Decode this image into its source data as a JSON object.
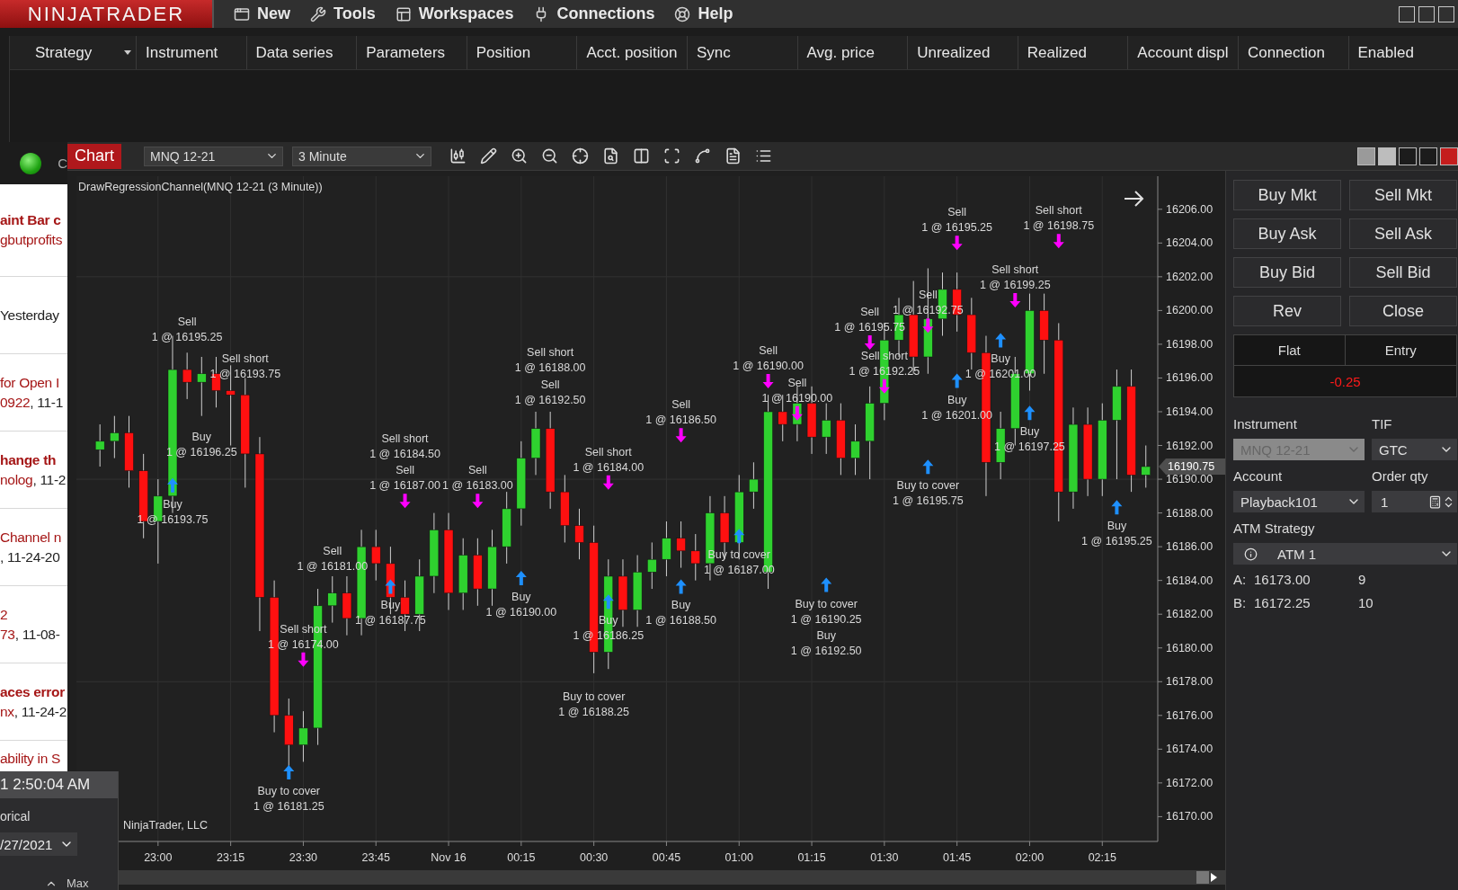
{
  "app": {
    "logo": "NINJATRADER",
    "menu": [
      {
        "label": "New"
      },
      {
        "label": "Tools"
      },
      {
        "label": "Workspaces"
      },
      {
        "label": "Connections"
      },
      {
        "label": "Help"
      }
    ]
  },
  "strategies": {
    "columns": [
      "Strategy",
      "Instrument",
      "Data series",
      "Parameters",
      "Position",
      "Acct. position",
      "Sync",
      "Avg. price",
      "Unrealized",
      "Realized",
      "Account displ",
      "Connection",
      "Enabled"
    ]
  },
  "status": {
    "label": "C"
  },
  "forum_posts": [
    {
      "title": "aint Bar c",
      "unread": true,
      "author": "gbutprofits"
    },
    {
      "date": "Yesterday"
    },
    {
      "title": "for Open I",
      "unread": false,
      "author": "0922",
      "date": ", 11-1"
    },
    {
      "title": "hange th",
      "unread": true,
      "author": "nolog",
      "date": ", 11-2"
    },
    {
      "title": "Channel n",
      "unread": false,
      "date": ", 11-24-20"
    },
    {
      "title": "2",
      "unread": false,
      "author": "73",
      "date": ", 11-08-"
    },
    {
      "title": "aces error",
      "unread": true,
      "author": "nx",
      "date": ", 11-24-2"
    },
    {
      "title": "ability in S",
      "unread": false
    }
  ],
  "clock_panel": {
    "time": "1 2:50:04 AM",
    "mode": "orical",
    "date": "/27/2021",
    "max_label": "Max"
  },
  "chart_window": {
    "tab": "Chart",
    "instrument": "MNQ 12-21",
    "interval": "3 Minute",
    "indicator": "DrawRegressionChannel(MNQ 12-21 (3 Minute))",
    "copyright": "NinjaTrader, LLC",
    "last_price": "16190.75",
    "chart_data": {
      "type": "candlestick",
      "grid": true,
      "ylim": [
        16168.53,
        16207.96
      ],
      "categories": [
        null,
        null,
        null,
        null,
        "23:00",
        null,
        null,
        null,
        null,
        "23:15",
        null,
        null,
        null,
        null,
        "23:30",
        null,
        null,
        null,
        null,
        "23:45",
        null,
        null,
        null,
        null,
        "Nov 16",
        null,
        null,
        null,
        null,
        "00:15",
        null,
        null,
        null,
        null,
        "00:30",
        null,
        null,
        null,
        null,
        "00:45",
        null,
        null,
        null,
        null,
        "01:00",
        null,
        null,
        null,
        null,
        "01:15",
        null,
        null,
        null,
        null,
        "01:30",
        null,
        null,
        null,
        null,
        "01:45",
        null,
        null,
        null,
        null,
        "02:00",
        null,
        null,
        null,
        null,
        "02:15",
        null,
        null,
        null
      ],
      "yticks": [
        {
          "value": 16206,
          "label": "16206.00"
        },
        {
          "value": 16204,
          "label": "16204.00"
        },
        {
          "value": 16202,
          "label": "16202.00"
        },
        {
          "value": 16200,
          "label": "16200.00"
        },
        {
          "value": 16198,
          "label": "16198.00"
        },
        {
          "value": 16196,
          "label": "16196.00"
        },
        {
          "value": 16194,
          "label": "16194.00"
        },
        {
          "value": 16192,
          "label": "16192.00"
        },
        {
          "value": 16190,
          "label": "16190.00"
        },
        {
          "value": 16188,
          "label": "16188.00"
        },
        {
          "value": 16186,
          "label": "16186.00"
        },
        {
          "value": 16184,
          "label": "16184.00"
        },
        {
          "value": 16182,
          "label": "16182.00"
        },
        {
          "value": 16180,
          "label": "16180.00"
        },
        {
          "value": 16178,
          "label": "16178.00"
        },
        {
          "value": 16176,
          "label": "16176.00"
        },
        {
          "value": 16174,
          "label": "16174.00"
        },
        {
          "value": 16172,
          "label": "16172.00"
        },
        {
          "value": 16170,
          "label": "16170.00"
        }
      ],
      "ohlc": [
        [
          16191.75,
          16193.25,
          16190.75,
          16192.25
        ],
        [
          16192.25,
          16193.75,
          16191.25,
          16192.75
        ],
        [
          16192.75,
          16193.75,
          16189.5,
          16190.5
        ],
        [
          16190.5,
          16191.5,
          16186.5,
          16187.5
        ],
        [
          16187.5,
          16190,
          16185,
          16189
        ],
        [
          16189,
          16198.5,
          16188,
          16196.5
        ],
        [
          16196.5,
          16197.5,
          16194.75,
          16195.75
        ],
        [
          16195.75,
          16197.25,
          16193.75,
          16196.25
        ],
        [
          16196.25,
          16197.25,
          16194.25,
          16195.25
        ],
        [
          16195.25,
          16196.75,
          16192,
          16195
        ],
        [
          16195,
          16196,
          16189.5,
          16191.5
        ],
        [
          16191.5,
          16192.5,
          16181,
          16183
        ],
        [
          16183,
          16184,
          16175,
          16176
        ],
        [
          16176,
          16177,
          16173,
          16174.25
        ],
        [
          16174.25,
          16176.25,
          16173.25,
          16175.25
        ],
        [
          16175.25,
          16183.5,
          16174.25,
          16182.5
        ],
        [
          16182.5,
          16184.25,
          16181.5,
          16183.25
        ],
        [
          16183.25,
          16184.25,
          16180.75,
          16181.75
        ],
        [
          16181.75,
          16187,
          16180.75,
          16186
        ],
        [
          16186,
          16187,
          16184,
          16185
        ],
        [
          16185,
          16186,
          16182,
          16183
        ],
        [
          16183,
          16184,
          16181,
          16182
        ],
        [
          16182,
          16185.25,
          16181,
          16184.25
        ],
        [
          16184.25,
          16188,
          16183.25,
          16187
        ],
        [
          16187,
          16188,
          16182.25,
          16183.25
        ],
        [
          16183.25,
          16186.5,
          16182.25,
          16185.5
        ],
        [
          16185.5,
          16186.5,
          16182.5,
          16183.5
        ],
        [
          16183.5,
          16187,
          16182.5,
          16186
        ],
        [
          16186,
          16189.25,
          16185,
          16188.25
        ],
        [
          16188.25,
          16192.25,
          16187.25,
          16191.25
        ],
        [
          16191.25,
          16194,
          16190.25,
          16193
        ],
        [
          16193,
          16194,
          16188.25,
          16189.25
        ],
        [
          16189.25,
          16190.25,
          16186.25,
          16187.25
        ],
        [
          16187.25,
          16188.25,
          16185.25,
          16186.25
        ],
        [
          16186.25,
          16187.25,
          16178.5,
          16179.75
        ],
        [
          16179.75,
          16185.25,
          16178.75,
          16184.25
        ],
        [
          16184.25,
          16185.25,
          16181.25,
          16182.25
        ],
        [
          16182.25,
          16185.5,
          16181.25,
          16184.5
        ],
        [
          16184.5,
          16186.25,
          16183.5,
          16185.25
        ],
        [
          16185.25,
          16187.5,
          16184.25,
          16186.5
        ],
        [
          16186.5,
          16187.5,
          16184.75,
          16185.75
        ],
        [
          16185.75,
          16186.75,
          16184,
          16185
        ],
        [
          16185,
          16189,
          16184,
          16188
        ],
        [
          16188,
          16189,
          16185.25,
          16186.25
        ],
        [
          16186.25,
          16190.25,
          16185.25,
          16189.25
        ],
        [
          16189.25,
          16191,
          16188.25,
          16190
        ],
        [
          16184.5,
          16195,
          16183.5,
          16194
        ],
        [
          16194,
          16195,
          16192.25,
          16193.25
        ],
        [
          16193.25,
          16195.5,
          16192.25,
          16194.5
        ],
        [
          16194.5,
          16195.5,
          16191.5,
          16192.5
        ],
        [
          16192.5,
          16194.5,
          16191.5,
          16193.5
        ],
        [
          16193.5,
          16194.5,
          16190.25,
          16191.25
        ],
        [
          16191.25,
          16193.25,
          16190.25,
          16192.25
        ],
        [
          16192.25,
          16195.5,
          16190,
          16194.5
        ],
        [
          16194.5,
          16199.25,
          16193.5,
          16198.25
        ],
        [
          16198.25,
          16200.75,
          16197.25,
          16199.75
        ],
        [
          16199.75,
          16201.75,
          16196.25,
          16197.25
        ],
        [
          16197.25,
          16202.5,
          16196.25,
          16199.5
        ],
        [
          16199.5,
          16202.25,
          16198.5,
          16201.25
        ],
        [
          16201.25,
          16202.25,
          16198.75,
          16199.75
        ],
        [
          16199.75,
          16200.75,
          16196.5,
          16197.5
        ],
        [
          16197.5,
          16198.5,
          16189,
          16191
        ],
        [
          16191,
          16194,
          16190,
          16193
        ],
        [
          16193,
          16197.25,
          16192,
          16196.25
        ],
        [
          16196.25,
          16201,
          16195.25,
          16200
        ],
        [
          16200,
          16201,
          16196.25,
          16198.25
        ],
        [
          16198.25,
          16199.25,
          16187.5,
          16189.25
        ],
        [
          16189.25,
          16194.25,
          16188.25,
          16193.25
        ],
        [
          16193.25,
          16194.25,
          16189,
          16190
        ],
        [
          16190,
          16194.5,
          16189,
          16193.5
        ],
        [
          16193.5,
          16196.5,
          16190,
          16195.5
        ],
        [
          16195.5,
          16196.5,
          16189.25,
          16190.25
        ],
        [
          16190.25,
          16192,
          16189.5,
          16190.75
        ]
      ]
    },
    "trades": [
      {
        "kind": "sell",
        "action": "Sell",
        "fill": "1 @ 16195.25"
      },
      {
        "kind": "sell",
        "action": "Sell short",
        "fill": "1 @ 16193.75"
      },
      {
        "kind": "buy",
        "action": "Buy",
        "fill": "1 @ 16196.25"
      },
      {
        "kind": "buy",
        "action": "Buy",
        "fill": "1 @ 16193.75"
      },
      {
        "kind": "sell",
        "action": "Sell short",
        "fill": "1 @ 16184.50"
      },
      {
        "kind": "sell",
        "action": "Sell",
        "fill": "1 @ 16187.00"
      },
      {
        "kind": "sell",
        "action": "Sell",
        "fill": "1 @ 16183.00"
      },
      {
        "kind": "sell",
        "action": "Sell short",
        "fill": "1 @ 16188.00"
      },
      {
        "kind": "sell",
        "action": "Sell",
        "fill": "1 @ 16192.50"
      },
      {
        "kind": "sell",
        "action": "Sell short",
        "fill": "1 @ 16184.00"
      },
      {
        "kind": "sell",
        "action": "Sell",
        "fill": "1 @ 16186.50"
      },
      {
        "kind": "sell",
        "action": "Sell",
        "fill": "1 @ 16190.00"
      },
      {
        "kind": "sell",
        "action": "Sell",
        "fill": "1 @ 16190.00"
      },
      {
        "kind": "sell",
        "action": "Sell",
        "fill": "1 @ 16195.75"
      },
      {
        "kind": "sell",
        "action": "Sell short",
        "fill": "1 @ 16192.25"
      },
      {
        "kind": "sell",
        "action": "Sell",
        "fill": "1 @ 16192.75"
      },
      {
        "kind": "sell",
        "action": "Sell",
        "fill": "1 @ 16195.25"
      },
      {
        "kind": "sell",
        "action": "Sell short",
        "fill": "1 @ 16199.25"
      },
      {
        "kind": "sell",
        "action": "Sell short",
        "fill": "1 @ 16198.75"
      },
      {
        "kind": "buy",
        "action": "Buy",
        "fill": "1 @ 16201.00"
      },
      {
        "kind": "buy",
        "action": "Buy",
        "fill": "1 @ 16201.00"
      },
      {
        "kind": "buy",
        "action": "Buy",
        "fill": "1 @ 16197.25"
      },
      {
        "kind": "buy",
        "action": "Buy",
        "fill": "1 @ 16195.25"
      },
      {
        "kind": "buy",
        "action": "Buy to cover",
        "fill": "1 @ 16195.75"
      },
      {
        "kind": "buy",
        "action": "Buy to cover",
        "fill": "1 @ 16190.25"
      },
      {
        "kind": "buy",
        "action": "Buy",
        "fill": "1 @ 16192.50"
      },
      {
        "kind": "buy",
        "action": "Buy to cover",
        "fill": "1 @ 16187.00"
      },
      {
        "kind": "buy",
        "action": "Buy",
        "fill": "1 @ 16188.50"
      },
      {
        "kind": "buy",
        "action": "Buy",
        "fill": "1 @ 16186.25"
      },
      {
        "kind": "buy",
        "action": "Buy to cover",
        "fill": "1 @ 16188.25"
      },
      {
        "kind": "buy",
        "action": "Buy",
        "fill": "1 @ 16190.00"
      },
      {
        "kind": "buy",
        "action": "Buy",
        "fill": "1 @ 16187.75"
      },
      {
        "kind": "sell",
        "action": "Sell",
        "fill": "1 @ 16181.00"
      },
      {
        "kind": "sell",
        "action": "Sell short",
        "fill": "1 @ 16174.00"
      },
      {
        "kind": "buy",
        "action": "Buy to cover",
        "fill": "1 @ 16181.25"
      }
    ]
  },
  "chart_trader": {
    "buttons": [
      "Buy Mkt",
      "Sell Mkt",
      "Buy Ask",
      "Sell Ask",
      "Buy Bid",
      "Sell Bid",
      "Rev",
      "Close"
    ],
    "position": {
      "status": "Flat",
      "entry": "Entry",
      "pnl": "-0.25",
      "loss": true
    },
    "instrument": {
      "label": "Instrument",
      "value": "MNQ 12-21",
      "disabled": true
    },
    "tif": {
      "label": "TIF",
      "value": "GTC",
      "disabled": false
    },
    "account": {
      "label": "Account",
      "value": "Playback101",
      "disabled": false
    },
    "order_qty": {
      "label": "Order qty",
      "value": "1"
    },
    "atm": {
      "label": "ATM Strategy",
      "value": "ATM 1"
    },
    "quotes": [
      {
        "side": "A:",
        "price": "16173.00",
        "size": "9"
      },
      {
        "side": "B:",
        "price": "16172.25",
        "size": "10"
      }
    ]
  }
}
